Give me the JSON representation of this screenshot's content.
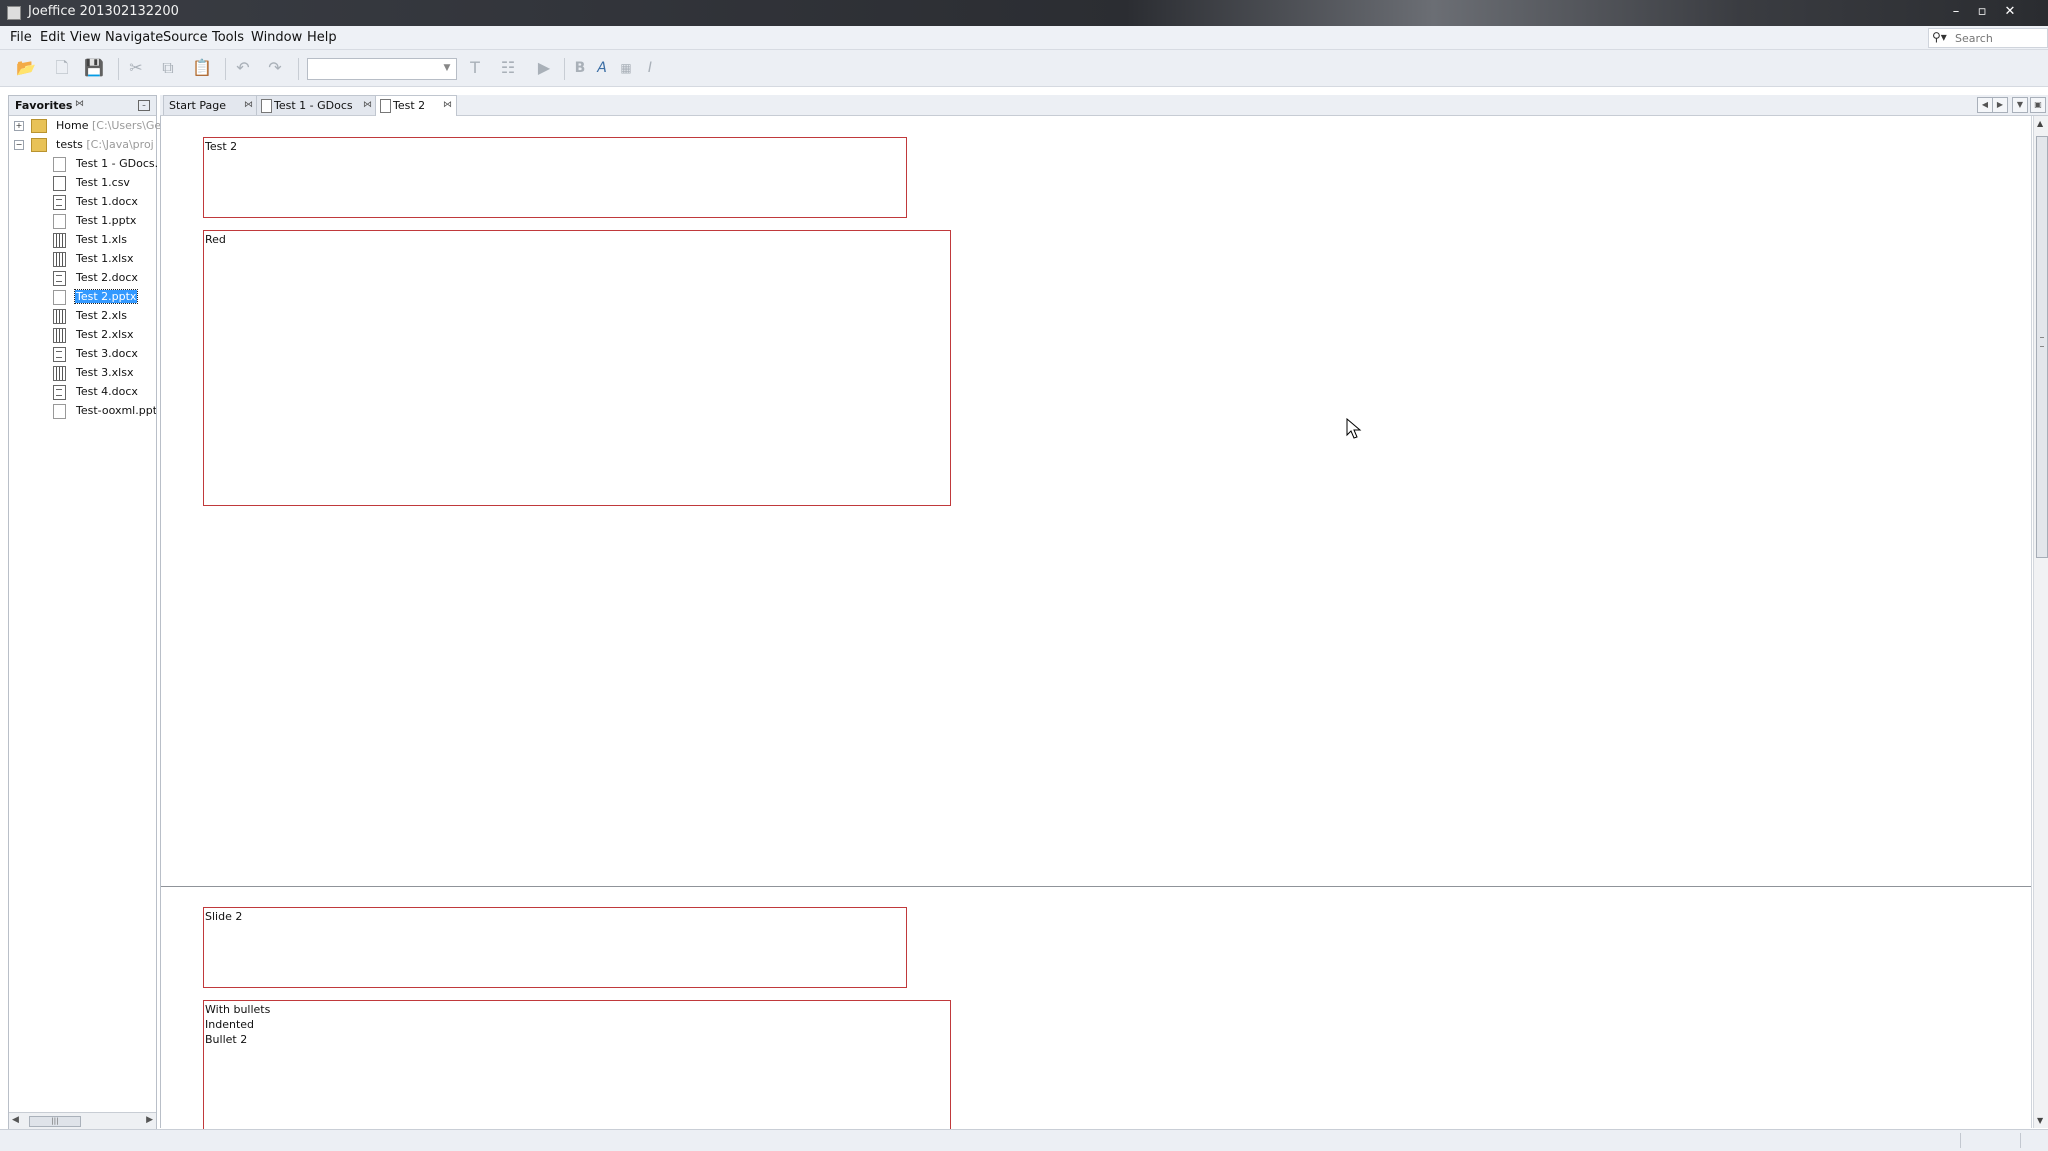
{
  "window": {
    "title": "Joeffice 201302132200",
    "buttons": [
      "–",
      "▫",
      "✕"
    ]
  },
  "menu": [
    "File",
    "Edit",
    "View",
    "Navigate",
    "Source",
    "Tools",
    "Window",
    "Help"
  ],
  "search": {
    "placeholder": "Search",
    "value": ""
  },
  "toolbar": {
    "combo_value": "",
    "icons": [
      "open-folder-icon",
      "new-file-icon",
      "save-icon",
      "cut-icon",
      "copy-icon",
      "paste-icon",
      "undo-icon",
      "redo-icon",
      "format-icon",
      "format-all-icon",
      "run-icon",
      "bold-icon",
      "text-color-icon",
      "highlight-icon",
      "italic-icon"
    ],
    "bold_glyph": "B",
    "italic_glyph": "I",
    "textcolor_glyph": "A"
  },
  "favorites": {
    "title": "Favorites",
    "items": [
      {
        "label": "Home",
        "path": "[C:\\Users\\Ge",
        "type": "folder",
        "toggle": "+"
      },
      {
        "label": "tests",
        "path": "[C:\\Java\\proj",
        "type": "folder",
        "toggle": "−"
      },
      {
        "label": "Test 1 - GDocs.",
        "type": "ppt"
      },
      {
        "label": "Test 1.csv",
        "type": "txt"
      },
      {
        "label": "Test 1.docx",
        "type": "doc"
      },
      {
        "label": "Test 1.pptx",
        "type": "ppt"
      },
      {
        "label": "Test 1.xls",
        "type": "xls"
      },
      {
        "label": "Test 1.xlsx",
        "type": "xls"
      },
      {
        "label": "Test 2.docx",
        "type": "doc"
      },
      {
        "label": "Test 2.pptx",
        "type": "ppt",
        "selected": true
      },
      {
        "label": "Test 2.xls",
        "type": "xls"
      },
      {
        "label": "Test 2.xlsx",
        "type": "xls"
      },
      {
        "label": "Test 3.docx",
        "type": "doc"
      },
      {
        "label": "Test 3.xlsx",
        "type": "xls"
      },
      {
        "label": "Test 4.docx",
        "type": "doc"
      },
      {
        "label": "Test-ooxml.ppt",
        "type": "ppt"
      }
    ]
  },
  "tabs": [
    {
      "label": "Start Page",
      "active": false,
      "has_icon": false
    },
    {
      "label": "Test 1 - GDocs",
      "active": false,
      "has_icon": true
    },
    {
      "label": "Test 2",
      "active": true,
      "has_icon": true
    }
  ],
  "slides": [
    {
      "shapes": [
        {
          "text": "Test 2"
        },
        {
          "text": "Red"
        }
      ]
    },
    {
      "shapes": [
        {
          "text": "Slide 2"
        },
        {
          "text": "With bullets\nIndented\nBullet 2"
        }
      ]
    }
  ]
}
